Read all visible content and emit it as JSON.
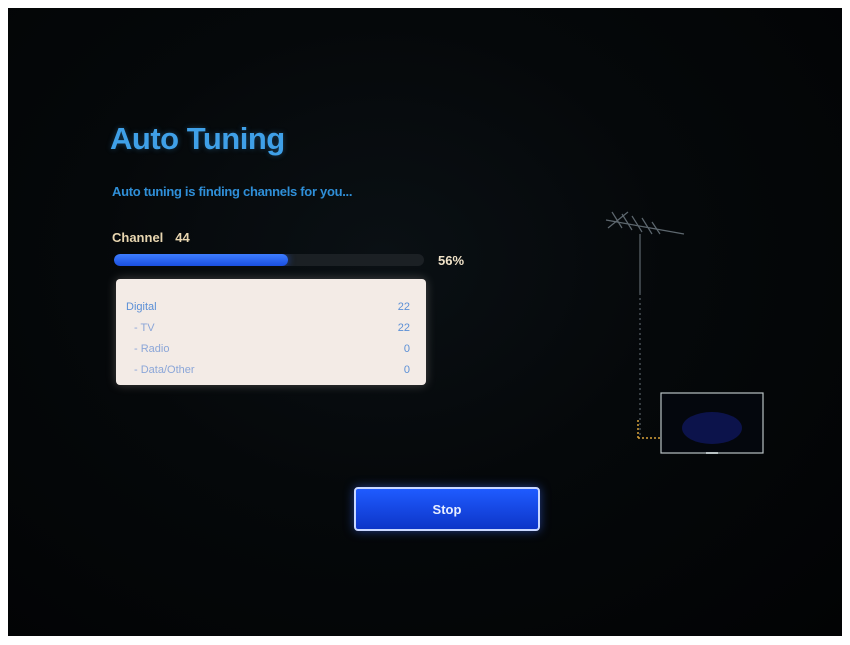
{
  "screen": {
    "title": "Auto Tuning",
    "subtitle": "Auto tuning is finding channels for you...",
    "channel_label": "Channel",
    "channel_number": "44",
    "progress_percent_text": "56%",
    "progress_fraction": 0.56
  },
  "results": {
    "rows": [
      {
        "label": "Digital",
        "value": "22"
      },
      {
        "label": "- TV",
        "value": "22"
      },
      {
        "label": "- Radio",
        "value": "0"
      },
      {
        "label": "- Data/Other",
        "value": "0"
      }
    ]
  },
  "buttons": {
    "stop_label": "Stop"
  },
  "colors": {
    "accent_blue": "#3fa0e8",
    "progress_blue": "#1a4fe0",
    "button_blue": "#1f5bff"
  },
  "icons": {
    "illustration": "antenna-tv-icon"
  }
}
